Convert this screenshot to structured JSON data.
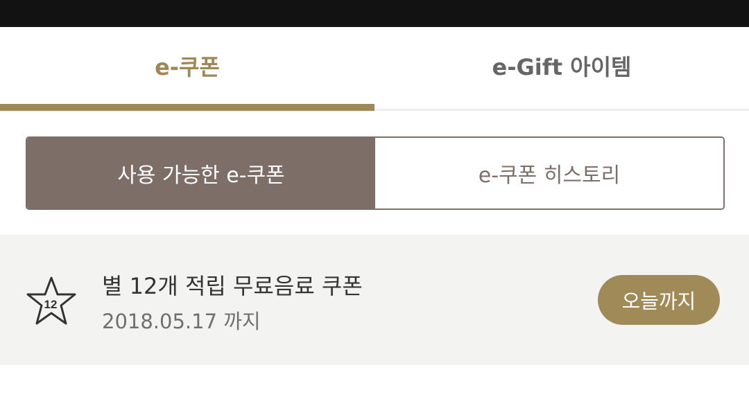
{
  "colors": {
    "accent": "#9f8756",
    "tab_active_text": "#9f8756",
    "tab_inactive_text": "#666666",
    "segment_active_bg": "#7d6f68",
    "segment_active_text": "#ffffff",
    "segment_inactive_text": "#7d6f68",
    "badge_bg": "#a08a57"
  },
  "tabs": [
    {
      "label": "e-쿠폰",
      "active": true
    },
    {
      "label": "e-Gift 아이템",
      "active": false
    }
  ],
  "segments": [
    {
      "label": "사용 가능한 e-쿠폰",
      "active": true
    },
    {
      "label": "e-쿠폰 히스토리",
      "active": false
    }
  ],
  "coupons": [
    {
      "icon": "star-icon",
      "star_count": "12",
      "title": "별 12개 적립 무료음료 쿠폰",
      "expiry": "2018.05.17 까지",
      "badge": "오늘까지"
    }
  ]
}
